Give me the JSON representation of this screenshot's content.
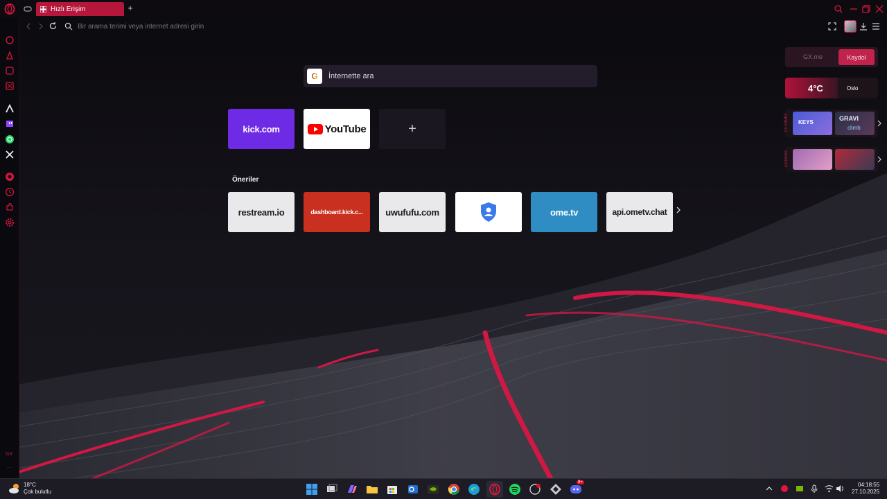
{
  "browser": {
    "tab_title": "Hızlı Erişim",
    "new_tab_symbol": "+",
    "address_placeholder": "Bir arama terimi veya internet adresi girin"
  },
  "speed_dial": {
    "search_logo": "G",
    "search_placeholder": "İnternette ara",
    "pinned": [
      {
        "label": "kick.com",
        "bg": "#6d2be6",
        "fg": "#ffffff"
      },
      {
        "label": "YouTube",
        "bg": "#ffffff",
        "fg": "#111111"
      }
    ],
    "add_symbol": "+",
    "suggestions_title": "Öneriler",
    "suggestions": [
      {
        "label": "restream.io",
        "bg": "#e9e9ec",
        "fg": "#1b1b22"
      },
      {
        "label": "dashboard.kick.c...",
        "bg": "#c9301f",
        "fg": "#ffffff"
      },
      {
        "label": "uwufufu.com",
        "bg": "#e9e9ec",
        "fg": "#1b1b22"
      },
      {
        "label": "",
        "bg": "#ffffff",
        "fg": "#1b1b22",
        "icon": "shield-user-icon"
      },
      {
        "label": "ome.tv",
        "bg": "#2f8dc3",
        "fg": "#ffffff"
      },
      {
        "label": "api.ometv.chat",
        "bg": "#e9e9ec",
        "fg": "#1b1b22"
      }
    ]
  },
  "widgets": {
    "gx_me": "GX.me",
    "signup": "Kaydol",
    "temperature": "4°C",
    "city": "Oslo",
    "games_side_label": "GX.GAMES",
    "mods_side_label": "GX MODS",
    "game_1_text": "KEYS",
    "game_2_text_top": "GRAVI",
    "game_2_text_bottom": "climb"
  },
  "sidebar_footer": "GX",
  "taskbar": {
    "weather_temp": "18°C",
    "weather_desc": "Çok bulutlu",
    "time": "04:18:55",
    "date": "27.10.2025",
    "discord_badge": "9+"
  },
  "colors": {
    "accent": "#b5163c",
    "bg": "#0b0a0f"
  }
}
